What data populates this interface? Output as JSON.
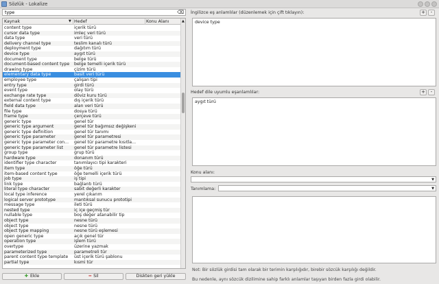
{
  "window": {
    "title": "Sözlük - Lokalize"
  },
  "search": {
    "value": "type",
    "placeholder": ""
  },
  "table": {
    "columns": [
      "Kaynak",
      "Hedef",
      "Konu Alanı"
    ],
    "selected_index": 9,
    "rows": [
      [
        "content type",
        "içerik türü"
      ],
      [
        "cursor data type",
        "imleç veri türü"
      ],
      [
        "data type",
        "veri türü"
      ],
      [
        "delivery channel type",
        "teslim kanalı türü"
      ],
      [
        "deployment type",
        "dağıtım türü"
      ],
      [
        "device type",
        "aygıt türü"
      ],
      [
        "document type",
        "belge türü"
      ],
      [
        "document-based content type",
        "belge temelli içerik türü"
      ],
      [
        "drawing type",
        "çizim türü"
      ],
      [
        "elementary data type",
        "basit veri türü"
      ],
      [
        "employee type",
        "çalışan tipi"
      ],
      [
        "entry type",
        "girdi türü"
      ],
      [
        "event type",
        "olay türü"
      ],
      [
        "exchange rate type",
        "döviz kuru türü"
      ],
      [
        "external content type",
        "dış içerik türü"
      ],
      [
        "field data type",
        "alan veri türü"
      ],
      [
        "file type",
        "dosya türü"
      ],
      [
        "frame type",
        "çerçeve türü"
      ],
      [
        "generic type",
        "genel tür"
      ],
      [
        "generic type argument",
        "genel tür bağımsız değişkeni"
      ],
      [
        "generic type definition",
        "genel tür tanımı"
      ],
      [
        "generic type parameter",
        "genel tür parametresi"
      ],
      [
        "generic type parameter con...",
        "genel tür parametre kısıtla..."
      ],
      [
        "generic type parameter list",
        "genel tür parametre listesi"
      ],
      [
        "group type",
        "grup türü"
      ],
      [
        "hardware type",
        "donanım türü"
      ],
      [
        "identifier type character",
        "tanımlayıcı tipi karakteri"
      ],
      [
        "item type",
        "öğe türü"
      ],
      [
        "item-based content type",
        "öğe temelli içerik türü"
      ],
      [
        "job type",
        "iş tipi"
      ],
      [
        "link type",
        "bağlantı türü"
      ],
      [
        "literal type character",
        "sabit değerli karakter"
      ],
      [
        "local type inference",
        "yerel çıkarım"
      ],
      [
        "logical server prototype",
        "mantıksal sunucu prototipi"
      ],
      [
        "message type",
        "ileti türü"
      ],
      [
        "nested type",
        "iç içe geçmiş tür"
      ],
      [
        "nullable type",
        "boş değer atanabilir tip"
      ],
      [
        "object type",
        "nesne türü"
      ],
      [
        "object type",
        "nesne türü"
      ],
      [
        "object type mapping",
        "nesne türü eşlemesi"
      ],
      [
        "open generic type",
        "açık genel tür"
      ],
      [
        "operation type",
        "işlem türü"
      ],
      [
        "overtype",
        "üzerine yazmak"
      ],
      [
        "parameterized type",
        "parametreli tür"
      ],
      [
        "parent content type template",
        "üst içerik türü şablonu"
      ],
      [
        "partial type",
        "kısmi tür"
      ]
    ]
  },
  "buttons": {
    "add": "Ekle",
    "delete": "Sil",
    "reload": "Diskten geri yükle"
  },
  "right": {
    "english_label": "İngilizce eş anlamlılar (düzenlemek için çift tıklayın):",
    "english_value": "device type",
    "target_label": "Hedef dile uyumlu eşanlamlılar:",
    "target_value": "aygıt türü",
    "subject_label": "Konu alanı:",
    "subject_value": "",
    "definition_label": "Tanımlama:",
    "definition_value": "",
    "note1": "Not: Bir sözlük girdisi tam olarak bir terimin karşılığıdır, birebir sözcük karşılığı değildir.",
    "note2": "Bu nedenle, aynı sözcük dizilimine sahip farklı anlamlar taşıyan birden fazla girdi olabilir."
  }
}
